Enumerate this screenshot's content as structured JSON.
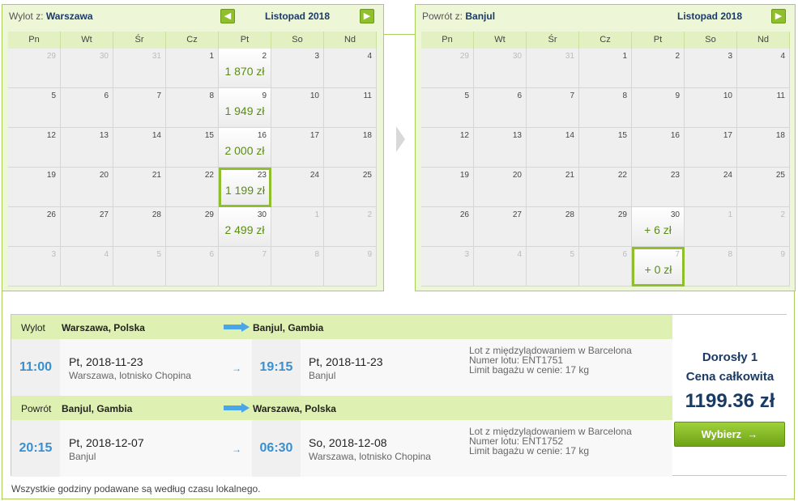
{
  "outbound_calendar": {
    "direction_label": "Wylot z:",
    "city": "Warszawa",
    "month": "Listopad 2018",
    "prev_icon": "arrow-left-icon",
    "next_icon": "arrow-right-icon",
    "weekdays": [
      "Pn",
      "Wt",
      "Śr",
      "Cz",
      "Pt",
      "So",
      "Nd"
    ],
    "weeks": [
      [
        {
          "n": "29",
          "o": true
        },
        {
          "n": "30",
          "o": true
        },
        {
          "n": "31",
          "o": true
        },
        {
          "n": "1"
        },
        {
          "n": "2",
          "price": "1 870 zł"
        },
        {
          "n": "3"
        },
        {
          "n": "4"
        }
      ],
      [
        {
          "n": "5"
        },
        {
          "n": "6"
        },
        {
          "n": "7"
        },
        {
          "n": "8"
        },
        {
          "n": "9",
          "price": "1 949 zł"
        },
        {
          "n": "10"
        },
        {
          "n": "11"
        }
      ],
      [
        {
          "n": "12"
        },
        {
          "n": "13"
        },
        {
          "n": "14"
        },
        {
          "n": "15"
        },
        {
          "n": "16",
          "price": "2 000 zł"
        },
        {
          "n": "17"
        },
        {
          "n": "18"
        }
      ],
      [
        {
          "n": "19"
        },
        {
          "n": "20"
        },
        {
          "n": "21"
        },
        {
          "n": "22"
        },
        {
          "n": "23",
          "price": "1 199 zł",
          "sel": true
        },
        {
          "n": "24"
        },
        {
          "n": "25"
        }
      ],
      [
        {
          "n": "26"
        },
        {
          "n": "27"
        },
        {
          "n": "28"
        },
        {
          "n": "29"
        },
        {
          "n": "30",
          "price": "2 499 zł"
        },
        {
          "n": "1",
          "o": true
        },
        {
          "n": "2",
          "o": true
        }
      ],
      [
        {
          "n": "3",
          "o": true
        },
        {
          "n": "4",
          "o": true
        },
        {
          "n": "5",
          "o": true
        },
        {
          "n": "6",
          "o": true
        },
        {
          "n": "7",
          "o": true
        },
        {
          "n": "8",
          "o": true
        },
        {
          "n": "9",
          "o": true
        }
      ]
    ]
  },
  "return_calendar": {
    "direction_label": "Powrót z:",
    "city": "Banjul",
    "month": "Listopad 2018",
    "next_icon": "arrow-right-icon",
    "weekdays": [
      "Pn",
      "Wt",
      "Śr",
      "Cz",
      "Pt",
      "So",
      "Nd"
    ],
    "weeks": [
      [
        {
          "n": "29",
          "o": true
        },
        {
          "n": "30",
          "o": true
        },
        {
          "n": "31",
          "o": true
        },
        {
          "n": "1"
        },
        {
          "n": "2"
        },
        {
          "n": "3"
        },
        {
          "n": "4"
        }
      ],
      [
        {
          "n": "5"
        },
        {
          "n": "6"
        },
        {
          "n": "7"
        },
        {
          "n": "8"
        },
        {
          "n": "9"
        },
        {
          "n": "10"
        },
        {
          "n": "11"
        }
      ],
      [
        {
          "n": "12"
        },
        {
          "n": "13"
        },
        {
          "n": "14"
        },
        {
          "n": "15"
        },
        {
          "n": "16"
        },
        {
          "n": "17"
        },
        {
          "n": "18"
        }
      ],
      [
        {
          "n": "19"
        },
        {
          "n": "20"
        },
        {
          "n": "21"
        },
        {
          "n": "22"
        },
        {
          "n": "23"
        },
        {
          "n": "24"
        },
        {
          "n": "25"
        }
      ],
      [
        {
          "n": "26"
        },
        {
          "n": "27"
        },
        {
          "n": "28"
        },
        {
          "n": "29"
        },
        {
          "n": "30",
          "price": "+ 6 zł"
        },
        {
          "n": "1",
          "o": true
        },
        {
          "n": "2",
          "o": true
        }
      ],
      [
        {
          "n": "3",
          "o": true
        },
        {
          "n": "4",
          "o": true
        },
        {
          "n": "5",
          "o": true
        },
        {
          "n": "6",
          "o": true
        },
        {
          "n": "7",
          "o": true,
          "price": "+ 0 zł",
          "sel": true
        },
        {
          "n": "8",
          "o": true
        },
        {
          "n": "9",
          "o": true
        }
      ]
    ]
  },
  "summary": {
    "outbound": {
      "label": "Wylot",
      "from": "Warszawa, Polska",
      "to": "Banjul, Gambia",
      "dep_time": "11:00",
      "dep_date": "Pt, 2018-11-23",
      "dep_place": "Warszawa, lotnisko Chopina",
      "arr_time": "19:15",
      "arr_date": "Pt, 2018-11-23",
      "arr_place": "Banjul",
      "info1": "Lot z międzylądowaniem w Barcelona",
      "info2": "Numer lotu: ENT1751",
      "info3": "Limit bagażu w cenie: 17 kg"
    },
    "return": {
      "label": "Powrót",
      "from": "Banjul, Gambia",
      "to": "Warszawa, Polska",
      "dep_time": "20:15",
      "dep_date": "Pt, 2018-12-07",
      "dep_place": "Banjul",
      "arr_time": "06:30",
      "arr_date": "So, 2018-12-08",
      "arr_place": "Warszawa, lotnisko Chopina",
      "info1": "Lot z międzylądowaniem w Barcelona",
      "info2": "Numer lotu: ENT1752",
      "info3": "Limit bagażu w cenie: 17 kg"
    },
    "passengers": "Dorosły 1",
    "total_label": "Cena całkowita",
    "total": "1199.36 zł",
    "select_label": "Wybierz",
    "select_icon_glyph": "→",
    "small_arrow_glyph": "→"
  },
  "footnote": "Wszystkie godziny podawane są według czasu lokalnego.",
  "colors": {
    "accent_green": "#8fbf2a",
    "price_green": "#5b8d14",
    "time_blue": "#3a8fd0",
    "navy": "#1a3a66"
  }
}
